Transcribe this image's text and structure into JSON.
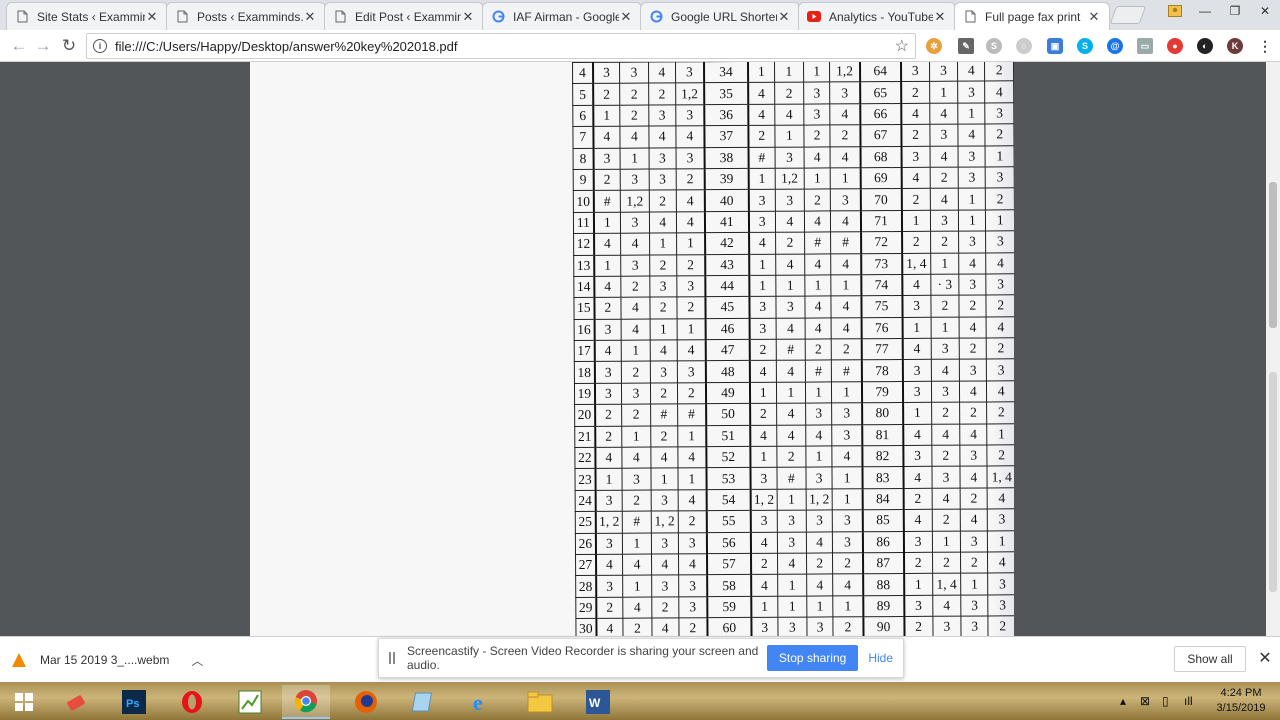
{
  "browser": {
    "tabs": [
      {
        "title": "Site Stats ‹ Examminds",
        "icon": "document-icon",
        "active": false
      },
      {
        "title": "Posts ‹ Examminds.c",
        "icon": "document-icon",
        "active": false
      },
      {
        "title": "Edit Post ‹ Examminds",
        "icon": "document-icon",
        "active": false
      },
      {
        "title": "IAF Airman - Google",
        "icon": "google-icon",
        "active": false
      },
      {
        "title": "Google URL Shorten",
        "icon": "google-icon",
        "active": false
      },
      {
        "title": "Analytics - YouTube",
        "icon": "youtube-icon",
        "active": false
      },
      {
        "title": "Full page fax print",
        "icon": "document-icon",
        "active": true
      }
    ],
    "url": "file:///C:/Users/Happy/Desktop/answer%20key%202018.pdf"
  },
  "answer_key": [
    [
      "4",
      "3",
      "3",
      "4",
      "3",
      "34",
      "1",
      "1",
      "1",
      "1,2",
      "64",
      "3",
      "3",
      "4",
      "2"
    ],
    [
      "5",
      "2",
      "2",
      "2",
      "1,2",
      "35",
      "4",
      "2",
      "3",
      "3",
      "65",
      "2",
      "1",
      "3",
      "4"
    ],
    [
      "6",
      "1",
      "2",
      "3",
      "3",
      "36",
      "4",
      "4",
      "3",
      "4",
      "66",
      "4",
      "4",
      "1",
      "3"
    ],
    [
      "7",
      "4",
      "4",
      "4",
      "4",
      "37",
      "2",
      "1",
      "2",
      "2",
      "67",
      "2",
      "3",
      "4",
      "2"
    ],
    [
      "8",
      "3",
      "1",
      "3",
      "3",
      "38",
      "#",
      "3",
      "4",
      "4",
      "68",
      "3",
      "4",
      "3",
      "1"
    ],
    [
      "9",
      "2",
      "3",
      "3",
      "2",
      "39",
      "1",
      "1,2",
      "1",
      "1",
      "69",
      "4",
      "2",
      "3",
      "3"
    ],
    [
      "10",
      "#",
      "1,2",
      "2",
      "4",
      "40",
      "3",
      "3",
      "2",
      "3",
      "70",
      "2",
      "4",
      "1",
      "2"
    ],
    [
      "11",
      "1",
      "3",
      "4",
      "4",
      "41",
      "3",
      "4",
      "4",
      "4",
      "71",
      "1",
      "3",
      "1",
      "1"
    ],
    [
      "12",
      "4",
      "4",
      "1",
      "1",
      "42",
      "4",
      "2",
      "#",
      "#",
      "72",
      "2",
      "2",
      "3",
      "3"
    ],
    [
      "13",
      "1",
      "3",
      "2",
      "2",
      "43",
      "1",
      "4",
      "4",
      "4",
      "73",
      "1, 4",
      "1",
      "4",
      "4"
    ],
    [
      "14",
      "4",
      "2",
      "3",
      "3",
      "44",
      "1",
      "1",
      "1",
      "1",
      "74",
      "4",
      "· 3",
      "3",
      "3"
    ],
    [
      "15",
      "2",
      "4",
      "2",
      "2",
      "45",
      "3",
      "3",
      "4",
      "4",
      "75",
      "3",
      "2",
      "2",
      "2"
    ],
    [
      "16",
      "3",
      "4",
      "1",
      "1",
      "46",
      "3",
      "4",
      "4",
      "4",
      "76",
      "1",
      "1",
      "4",
      "4"
    ],
    [
      "17",
      "4",
      "1",
      "4",
      "4",
      "47",
      "2",
      "#",
      "2",
      "2",
      "77",
      "4",
      "3",
      "2",
      "2"
    ],
    [
      "18",
      "3",
      "2",
      "3",
      "3",
      "48",
      "4",
      "4",
      "#",
      "#",
      "78",
      "3",
      "4",
      "3",
      "3"
    ],
    [
      "19",
      "3",
      "3",
      "2",
      "2",
      "49",
      "1",
      "1",
      "1",
      "1",
      "79",
      "3",
      "3",
      "4",
      "4"
    ],
    [
      "20",
      "2",
      "2",
      "#",
      "#",
      "50",
      "2",
      "4",
      "3",
      "3",
      "80",
      "1",
      "2",
      "2",
      "2"
    ],
    [
      "21",
      "2",
      "1",
      "2",
      "1",
      "51",
      "4",
      "4",
      "4",
      "3",
      "81",
      "4",
      "4",
      "4",
      "1"
    ],
    [
      "22",
      "4",
      "4",
      "4",
      "4",
      "52",
      "1",
      "2",
      "1",
      "4",
      "82",
      "3",
      "2",
      "3",
      "2"
    ],
    [
      "23",
      "1",
      "3",
      "1",
      "1",
      "53",
      "3",
      "#",
      "3",
      "1",
      "83",
      "4",
      "3",
      "4",
      "1, 4"
    ],
    [
      "24",
      "3",
      "2",
      "3",
      "4",
      "54",
      "1, 2",
      "1",
      "1, 2",
      "1",
      "84",
      "2",
      "4",
      "2",
      "4"
    ],
    [
      "25",
      "1, 2",
      "#",
      "1, 2",
      "2",
      "55",
      "3",
      "3",
      "3",
      "3",
      "85",
      "4",
      "2",
      "4",
      "3"
    ],
    [
      "26",
      "3",
      "1",
      "3",
      "3",
      "56",
      "4",
      "3",
      "4",
      "3",
      "86",
      "3",
      "1",
      "3",
      "1"
    ],
    [
      "27",
      "4",
      "4",
      "4",
      "4",
      "57",
      "2",
      "4",
      "2",
      "2",
      "87",
      "2",
      "2",
      "2",
      "4"
    ],
    [
      "28",
      "3",
      "1",
      "3",
      "3",
      "58",
      "4",
      "1",
      "4",
      "4",
      "88",
      "1",
      "1, 4",
      "1",
      "3"
    ],
    [
      "29",
      "2",
      "4",
      "2",
      "3",
      "59",
      "1",
      "1",
      "1",
      "1",
      "89",
      "3",
      "4",
      "3",
      "3"
    ],
    [
      "30",
      "4",
      "2",
      "4",
      "2",
      "60",
      "3",
      "3",
      "3",
      "2",
      "90",
      "2",
      "3",
      "3",
      "2"
    ]
  ],
  "downloads": {
    "file_name": "Mar 15 2019 3_....webm",
    "show_all": "Show all"
  },
  "notification": {
    "message": "Screencastify - Screen Video Recorder is sharing your screen and audio.",
    "stop_label": "Stop sharing",
    "hide_label": "Hide"
  },
  "clock": {
    "time": "4:24 PM",
    "date": "3/15/2019"
  },
  "colors": {
    "accent": "#4285f4",
    "taskbar": "#b8a16b",
    "viewer_bg": "#525659"
  }
}
